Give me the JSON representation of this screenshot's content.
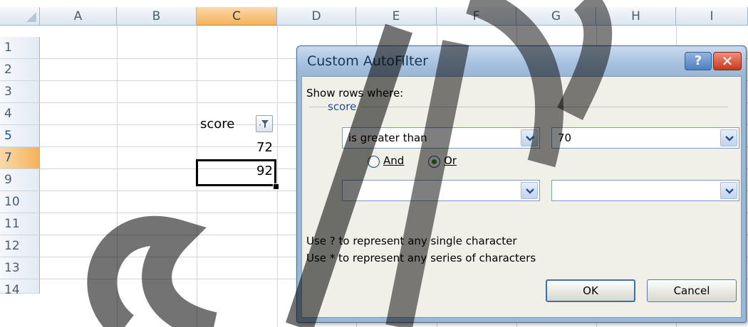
{
  "spreadsheet": {
    "columns": [
      "A",
      "B",
      "C",
      "D",
      "E",
      "F",
      "G",
      "H",
      "I"
    ],
    "selected_column": "C",
    "rows": [
      "1",
      "2",
      "3",
      "4",
      "5",
      "7",
      "9",
      "10",
      "11",
      "12",
      "13",
      "14"
    ],
    "selected_row": "7",
    "header_cell_text": "score",
    "values": {
      "row5": "72",
      "row7": "92"
    }
  },
  "dialog": {
    "title": "Custom AutoFilter",
    "help_label": "?",
    "close_label": "✕",
    "show_rows_label": "Show rows where:",
    "group_label": "score",
    "condition1": {
      "operator": "is greater than",
      "value": "70"
    },
    "logic": {
      "and_label": "And",
      "or_label": "Or",
      "selected": "Or"
    },
    "condition2": {
      "operator": "",
      "value": ""
    },
    "hint1": "Use ? to represent any single character",
    "hint2": "Use * to represent any series of characters",
    "ok_label": "OK",
    "cancel_label": "Cancel"
  },
  "colors": {
    "selected_header": "#f5b25a",
    "title_bar": "#a5c1df",
    "close_button": "#c6391f",
    "radio_selected": "#2b8a2b"
  },
  "icons": [
    "autofilter-icon",
    "dropdown-arrow-icon",
    "help-icon",
    "close-icon"
  ]
}
